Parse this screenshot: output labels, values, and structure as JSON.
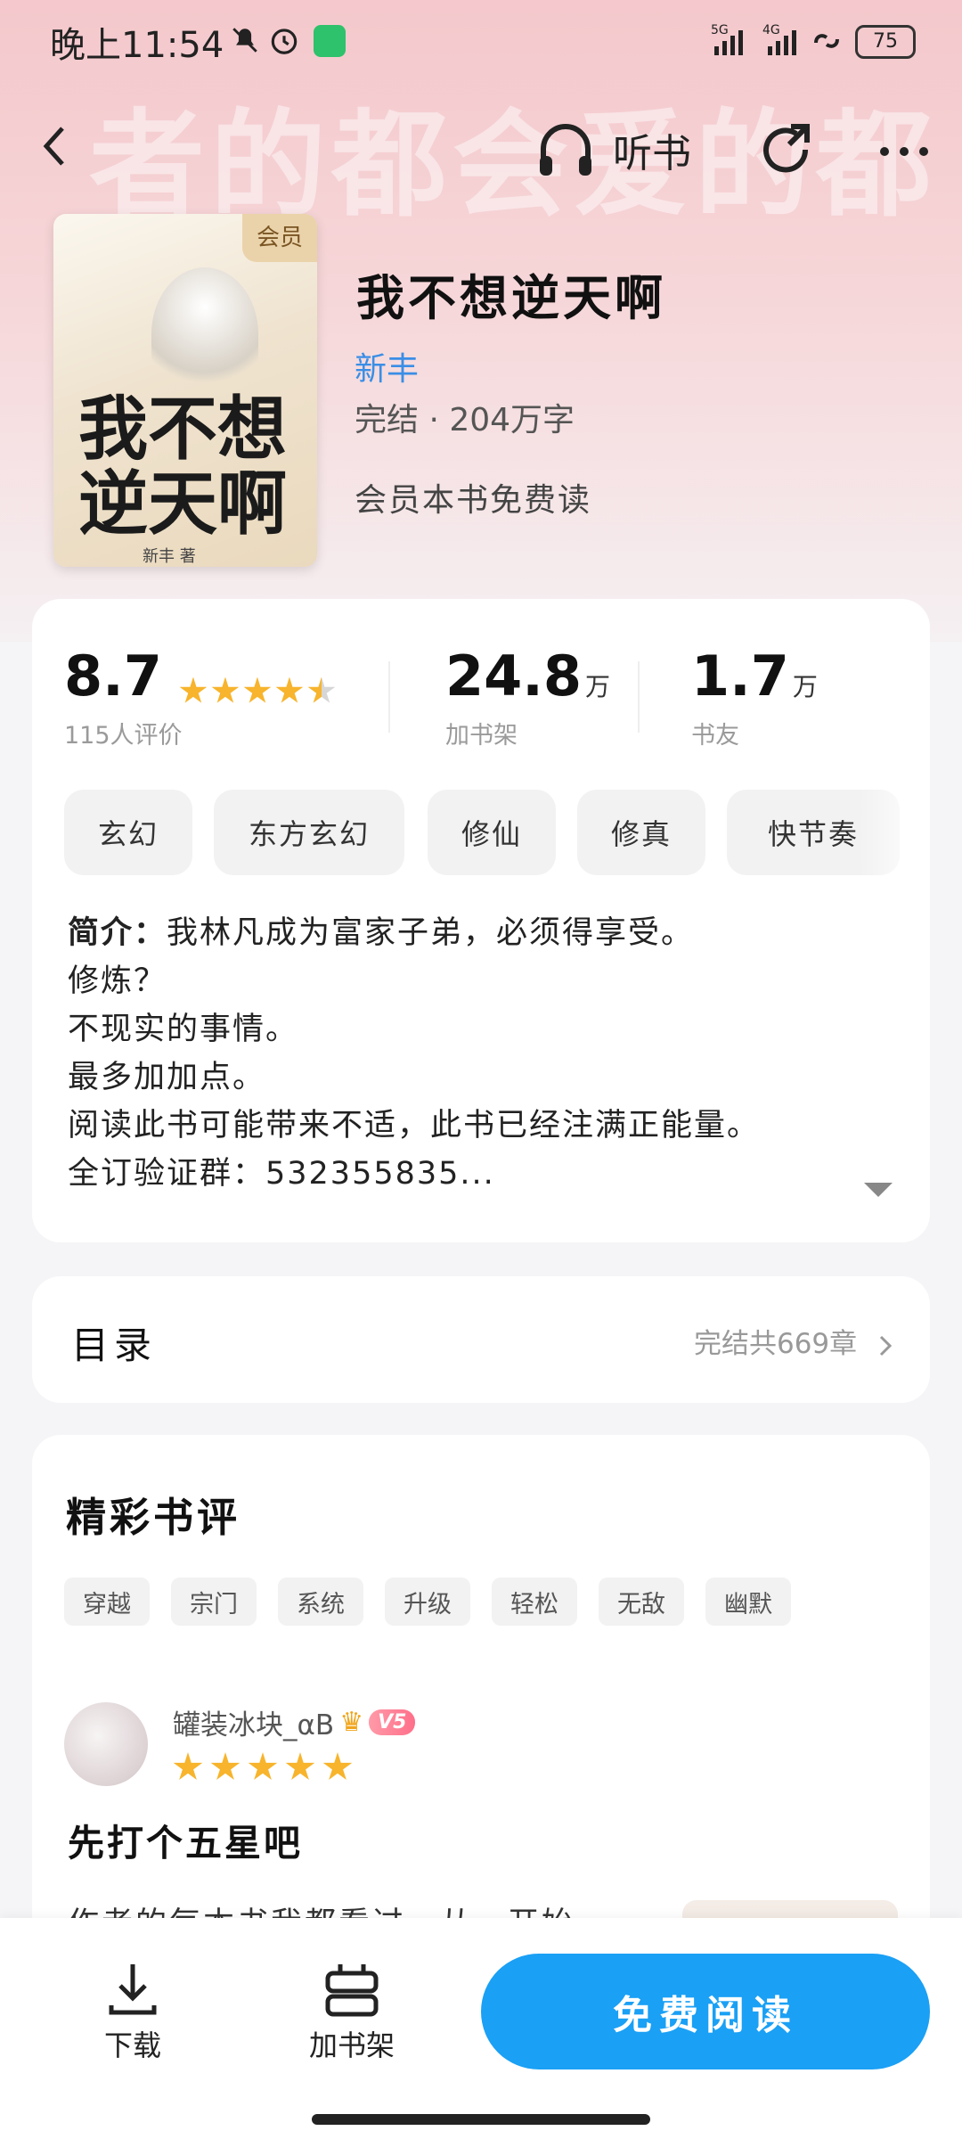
{
  "status_bar": {
    "time": "晚上11:54",
    "network_5g": "5G",
    "network_4g": "4G",
    "battery": "75"
  },
  "nav": {
    "listen_label": "听书"
  },
  "book": {
    "cover_badge": "会员",
    "cover_title": "我不想逆天啊",
    "cover_author": "新丰 著",
    "title": "我不想逆天啊",
    "author": "新丰",
    "meta": "完结 · 204万字",
    "vip_note": "会员本书免费读"
  },
  "stats": {
    "rating": "8.7",
    "rating_stars": 4.5,
    "rating_count_label": "115人评价",
    "shelf_num": "24.8",
    "shelf_unit": "万",
    "shelf_label": "加书架",
    "fans_num": "1.7",
    "fans_unit": "万",
    "fans_label": "书友"
  },
  "tags": [
    "玄幻",
    "东方玄幻",
    "修仙",
    "修真",
    "快节奏"
  ],
  "intro": {
    "label": "简介：",
    "first_line": "我林凡成为富家子弟，必须得享受。",
    "lines": [
      "修炼？",
      "不现实的事情。",
      "最多加加点。",
      "阅读此书可能带来不适，此书已经注满正能量。",
      "全订验证群：532355835..."
    ]
  },
  "toc": {
    "title": "目录",
    "summary": "完结共669章"
  },
  "reviews": {
    "title": "精彩书评",
    "tags": [
      "穿越",
      "宗门",
      "系统",
      "升级",
      "轻松",
      "无敌",
      "幽默"
    ],
    "first": {
      "user": "罐装冰块_αB",
      "vip_level": "V5",
      "stars": 5,
      "headline": "先打个五星吧",
      "body_preview": "作者的每本书我都看过，从一开始"
    }
  },
  "bottom_bar": {
    "download_label": "下载",
    "shelf_label": "加书架",
    "read_label": "免费阅读"
  },
  "colors": {
    "accent_blue": "#1aa0f5",
    "author_blue": "#3a8ee6",
    "star": "#f7b42c"
  }
}
